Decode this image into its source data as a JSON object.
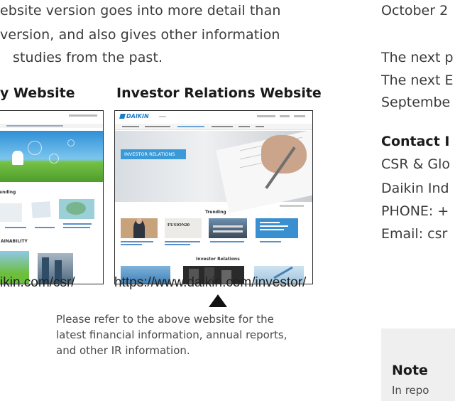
{
  "intro": {
    "line1": "ebsite version goes into more detail than",
    "line2": "version, and also gives other information",
    "line3": "studies from the past."
  },
  "left_site": {
    "heading": "y Website",
    "url": "ikin.com/csr/",
    "trending": "ending",
    "section": "AINABILITY"
  },
  "right_site": {
    "heading": "Investor Relations Website",
    "url": "https://www.daikin.com/investor/",
    "logo": "DAIKIN",
    "hero_banner": "INVESTOR RELATIONS",
    "trending": "Trending",
    "section": "Investor Relations",
    "fusion": "FUSION20"
  },
  "refer_note": {
    "line1": "Please refer to the above website for the",
    "line2": "latest financial information, annual reports,",
    "line3": "and other IR information."
  },
  "right_column": {
    "date": "October 2",
    "next1": "The next p",
    "next2": "The next E",
    "next3": "Septembe",
    "contact_title": "Contact I",
    "contact1": "CSR & Glo",
    "contact2": "Daikin Ind",
    "contact3": "PHONE: +",
    "contact4": "Email: csr"
  },
  "note": {
    "title": "Note",
    "text": "In repo"
  },
  "colors": {
    "sky": "#4aa8de",
    "grass": "#6cbf3c",
    "daikin_blue": "#1c7dc4",
    "banner": "#3a9ad9",
    "water": "#5fb7d9"
  }
}
